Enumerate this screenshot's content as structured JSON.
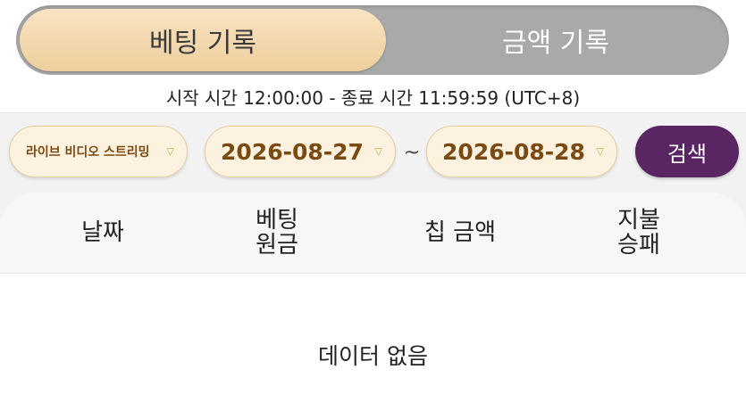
{
  "tabs": {
    "bet_history": "베팅 기록",
    "amount_history": "금액 기록"
  },
  "time_range": "시작 시간 12:00:00 - 종료 시간 11:59:59 (UTC+8)",
  "filter": {
    "game_type": "라이브 비디오 스트리밍",
    "start_date": "2026-08-27",
    "separator": "~",
    "end_date": "2026-08-28",
    "search_label": "검색"
  },
  "table": {
    "col_date": "날짜",
    "col_bet_line1": "베팅",
    "col_bet_line2": "원금",
    "col_chip": "칩 금액",
    "col_pay_line1": "지불",
    "col_pay_line2": "승패"
  },
  "empty_message": "데이터 없음",
  "colors": {
    "tab_active": "#efcf9d",
    "tab_track": "#a9a9a9",
    "search_button": "#5a2563",
    "pill_bg": "#fdf2df",
    "pill_text": "#7a4a12"
  },
  "icons": {
    "dropdown": "chevron-down-icon"
  }
}
